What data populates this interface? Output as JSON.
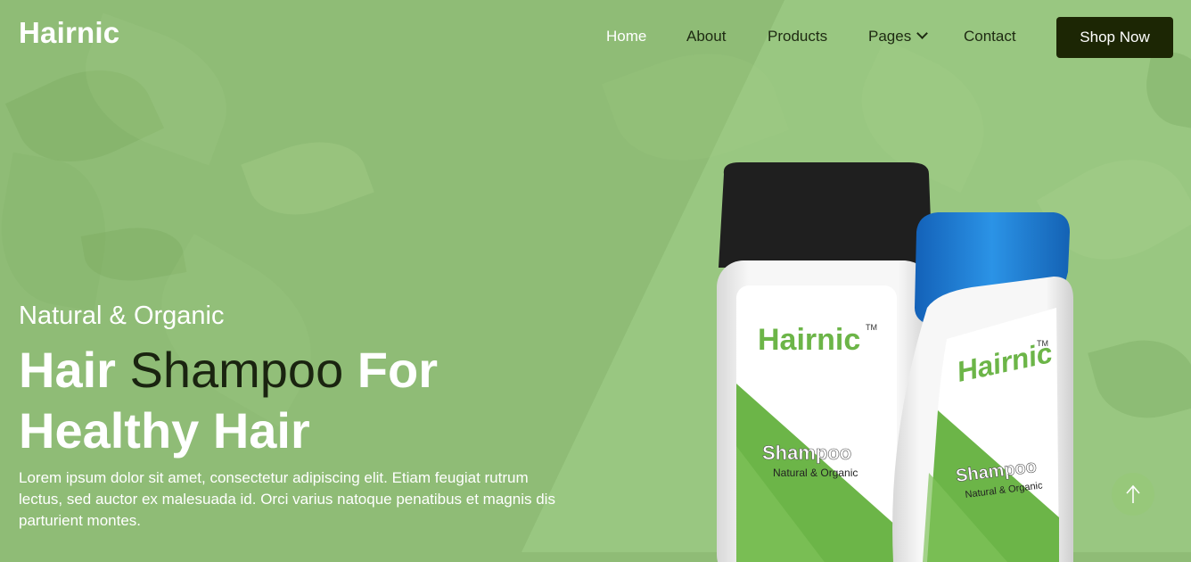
{
  "brand": {
    "logo_text": "Hairnic"
  },
  "nav": {
    "items": [
      {
        "label": "Home",
        "active": true
      },
      {
        "label": "About"
      },
      {
        "label": "Products"
      },
      {
        "label": "Pages",
        "has_dropdown": true
      },
      {
        "label": "Contact"
      }
    ],
    "cta_label": "Shop Now"
  },
  "hero": {
    "subtitle": "Natural & Organic",
    "headline_part1": "Hair",
    "headline_part2": "Shampoo",
    "headline_part3": "For",
    "headline_line2": "Healthy Hair",
    "description": "Lorem ipsum dolor sit amet, consectetur adipiscing elit. Etiam feugiat rutrum lectus, sed auctor ex malesuada id. Orci varius natoque penatibus et magnis dis parturient montes."
  },
  "product": {
    "brand": "Hairnic",
    "trademark": "TM",
    "label": "Shampoo",
    "tagline": "Natural & Organic"
  },
  "icons": {
    "scroll_top": "arrow-up-icon",
    "dropdown": "chevron-down-icon"
  },
  "colors": {
    "background": "#8fbc76",
    "accent_dark": "#1c2604",
    "bottle_green": "#6cb548",
    "cap_black": "#1f1f1f",
    "cap_blue": "#1a7fd6"
  }
}
